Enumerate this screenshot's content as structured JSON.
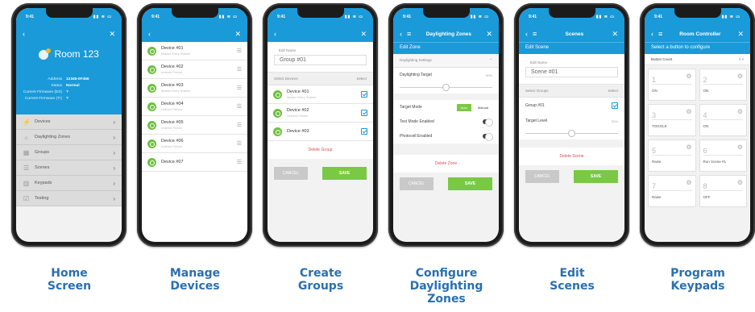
{
  "status_time": "9:41",
  "status_icons": "▮▮ ≋ ▭",
  "home": {
    "title": "Room 123",
    "info": [
      {
        "k": "Address",
        "v": "12345-0F456"
      },
      {
        "k": "Status",
        "v": "Normal"
      },
      {
        "k": "Current Firmware (ES)",
        "v": "?"
      },
      {
        "k": "Current Firmware (TI)",
        "v": "?"
      }
    ],
    "menu": [
      {
        "label": "Devices",
        "icon": "⚡"
      },
      {
        "label": "Daylighting Zones",
        "icon": "☼"
      },
      {
        "label": "Groups",
        "icon": "▦"
      },
      {
        "label": "Scenes",
        "icon": "☰"
      },
      {
        "label": "Keypads",
        "icon": "▥"
      },
      {
        "label": "Testing",
        "icon": "☑"
      }
    ]
  },
  "devices": {
    "items": [
      {
        "name": "Device #01",
        "sub": "Master Entry Station"
      },
      {
        "name": "Device #02",
        "sub": "Indirect Fixture"
      },
      {
        "name": "Device #03",
        "sub": "Master Entry Station"
      },
      {
        "name": "Device #04",
        "sub": "Indirect Fixture"
      },
      {
        "name": "Device #05",
        "sub": "Indirect Fixture"
      },
      {
        "name": "Device #06",
        "sub": "Indirect Fixture"
      },
      {
        "name": "Device #07",
        "sub": ""
      }
    ]
  },
  "groups": {
    "edit_label": "Edit Name",
    "name_value": "Group #01",
    "select_devices": "Select Devices",
    "select": "Select",
    "items": [
      {
        "name": "Device #01",
        "sub": "Master Entry Station"
      },
      {
        "name": "Device #02",
        "sub": "Indirect Fixture"
      },
      {
        "name": "Device #03",
        "sub": ""
      }
    ],
    "delete": "Delete Group",
    "cancel": "CANCEL",
    "save": "SAVE"
  },
  "zones": {
    "nav_title": "Daylighting Zones",
    "sub_title": "Edit Zone",
    "section": "Daylighting Settings",
    "target_label": "Daylighting Target",
    "target_value": "50%",
    "target_level": 0.5,
    "mode_label": "Target Mode",
    "mode_auto": "Auto",
    "mode_manual": "Manual",
    "test_mode": "Test Mode Enabled",
    "photocell": "Photocell Enabled",
    "delete": "Delete Zone",
    "cancel": "CANCEL",
    "save": "SAVE"
  },
  "scenes": {
    "nav_title": "Scenes",
    "sub_title": "Edit Scene",
    "edit_label": "Edit Name",
    "name_value": "Scene #01",
    "select_groups": "Select Groups",
    "select": "Select",
    "group": "Group #01",
    "target_level": "Target Level",
    "target_value": "50%",
    "level": 0.5,
    "delete": "Delete Scene",
    "cancel": "CANCEL",
    "save": "SAVE"
  },
  "keypads": {
    "nav_title": "Room Controller",
    "sub_title": "Select a button to configure",
    "button_count": "Button Count",
    "count_value": "8",
    "buttons": [
      {
        "num": "1",
        "label": "ON"
      },
      {
        "num": "2",
        "label": "ON"
      },
      {
        "num": "3",
        "label": "TOGGLE"
      },
      {
        "num": "4",
        "label": "ON"
      },
      {
        "num": "5",
        "label": "Raise"
      },
      {
        "num": "6",
        "label": "Run Scene #1"
      },
      {
        "num": "7",
        "label": "Raise"
      },
      {
        "num": "8",
        "label": "OFF"
      }
    ]
  },
  "captions": [
    "Home\nScreen",
    "Manage\nDevices",
    "Create\nGroups",
    "Configure\nDaylighting\nZones",
    "Edit\nScenes",
    "Program\nKeypads"
  ]
}
